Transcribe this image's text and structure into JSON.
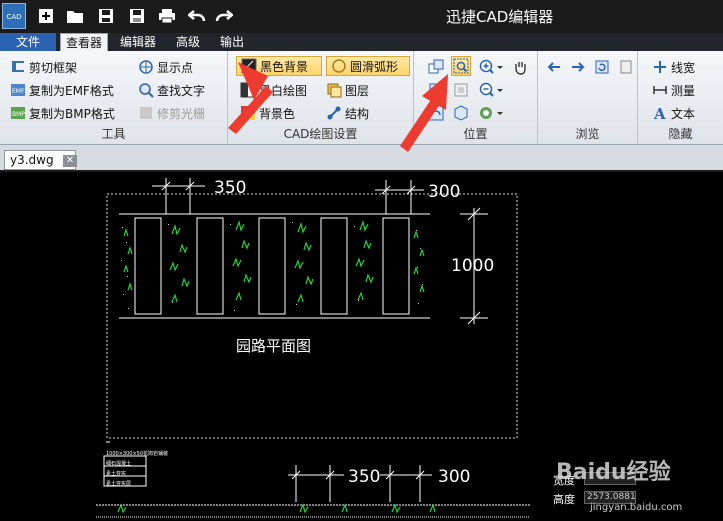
{
  "app": {
    "title": "迅捷CAD编辑器",
    "icon_text": "CAD"
  },
  "quick_access": [
    "add-icon",
    "folder-open-icon",
    "save-icon",
    "save-as-icon",
    "print-icon",
    "undo-icon",
    "redo-icon"
  ],
  "menu": {
    "file": "文件",
    "tabs": [
      "查看器",
      "编辑器",
      "高级",
      "输出"
    ],
    "active": "查看器"
  },
  "ribbon": {
    "tools": {
      "label": "工具",
      "clip_frame": "剪切框架",
      "copy_emf": "复制为EMF格式",
      "copy_bmp": "复制为BMP格式",
      "show_points": "显示点",
      "find_text": "查找文字",
      "trim_raster": "修剪光栅"
    },
    "cad_settings": {
      "label": "CAD绘图设置",
      "black_bg": "黑色背景",
      "smooth_arc": "圆滑弧形",
      "bw_drawing": "黑白绘图",
      "layers": "图层",
      "bg_color": "背景色",
      "structure": "结构"
    },
    "position": {
      "label": "位置"
    },
    "browse": {
      "label": "浏览"
    },
    "hide": {
      "label": "隐藏",
      "line_width": "线宽",
      "measure": "测量",
      "text": "文本"
    }
  },
  "document": {
    "tab_name": "y3.dwg"
  },
  "drawing": {
    "dim_350_top": "350",
    "dim_300_top": "300",
    "dim_1000": "1000",
    "caption": "园路平面图",
    "dim_350_bottom": "350",
    "dim_300_bottom": "300",
    "note_line": "1000×300×50花岗岩铺装",
    "legend_1": "细石混凝土",
    "legend_2": "素土夯实",
    "legend_3": "素土夯实层"
  },
  "status": {
    "width_label": "宽度",
    "height_label": "高度",
    "height_value": "2573.0881"
  },
  "watermark": {
    "brand": "Baidu经验",
    "url": "jingyan.baidu.com"
  },
  "colors": {
    "title_bar": "#1b1b1b",
    "file_tab": "#2b63b2",
    "ribbon": "#e8ecf1",
    "highlight": "#ffd46a",
    "canvas": "#000000",
    "arrow": "#ee3b2f",
    "grass": "#25d43a"
  }
}
